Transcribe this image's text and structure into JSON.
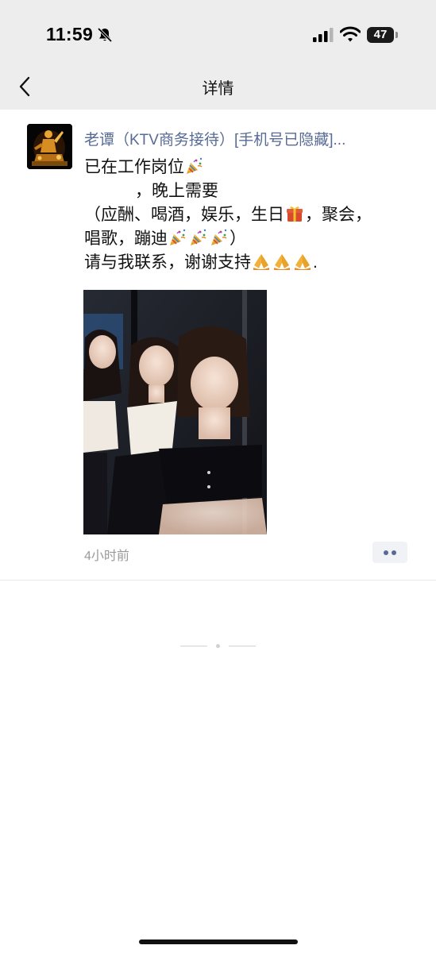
{
  "status_bar": {
    "time": "11:59",
    "battery": "47"
  },
  "nav": {
    "title": "详情"
  },
  "post": {
    "nickname": "老谭（KTV商务接待）[手机号已隐藏]...",
    "lines": {
      "l1": "已在工作岗位",
      "l2": "，晚上需要",
      "l3a": "（应酬、喝酒，娱乐，生日",
      "l3b": "，聚会，",
      "l4a": "唱歌，蹦迪",
      "l4b": "）",
      "l5a": "请与我联系，谢谢支持",
      "l5b": "."
    },
    "emojis": {
      "party": "party-popper-icon",
      "gift": "gift-icon",
      "pray": "folded-hands-icon"
    },
    "photo": "photo-of-three-women",
    "time_ago": "4小时前"
  },
  "colors": {
    "link": "#576b95",
    "header_bg": "#ededed",
    "meta": "#9a9a9a"
  }
}
